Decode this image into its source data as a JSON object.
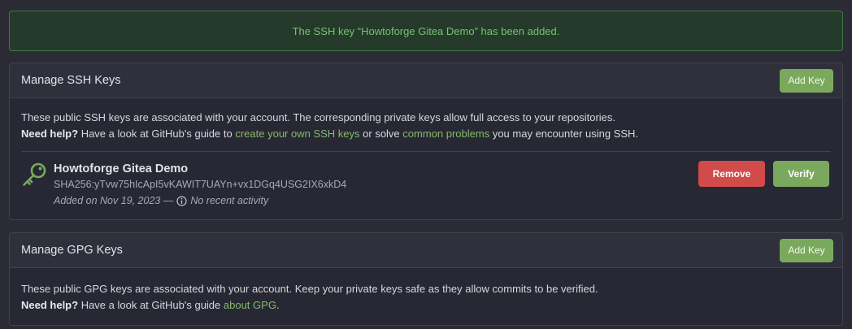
{
  "flash": {
    "message": "The SSH key “Howtoforge Gitea Demo” has been added."
  },
  "ssh": {
    "title": "Manage SSH Keys",
    "add_label": "Add Key",
    "desc_line1": "These public SSH keys are associated with your account. The corresponding private keys allow full access to your repositories.",
    "help_bold": "Need help?",
    "help_prefix": " Have a look at GitHub's guide to ",
    "help_link1": "create your own SSH keys",
    "help_mid": " or solve ",
    "help_link2": "common problems",
    "help_suffix": " you may encounter using SSH.",
    "keys": [
      {
        "name": "Howtoforge Gitea Demo",
        "fingerprint": "SHA256:yTvw75hIcApI5vKAWIT7UAYn+vx1DGq4USG2IX6xkD4",
        "added": "Added on Nov 19, 2023 —",
        "activity": "No recent activity",
        "remove_label": "Remove",
        "verify_label": "Verify",
        "icon": "key-icon"
      }
    ]
  },
  "gpg": {
    "title": "Manage GPG Keys",
    "add_label": "Add Key",
    "desc_line1": "These public GPG keys are associated with your account. Keep your private keys safe as they allow commits to be verified.",
    "help_bold": "Need help?",
    "help_prefix": " Have a look at GitHub's guide ",
    "help_link": "about GPG",
    "help_suffix": "."
  },
  "colors": {
    "accent": "#7aa95d",
    "danger": "#d24a4a",
    "success_text": "#74c46f",
    "link": "#86ba68"
  }
}
